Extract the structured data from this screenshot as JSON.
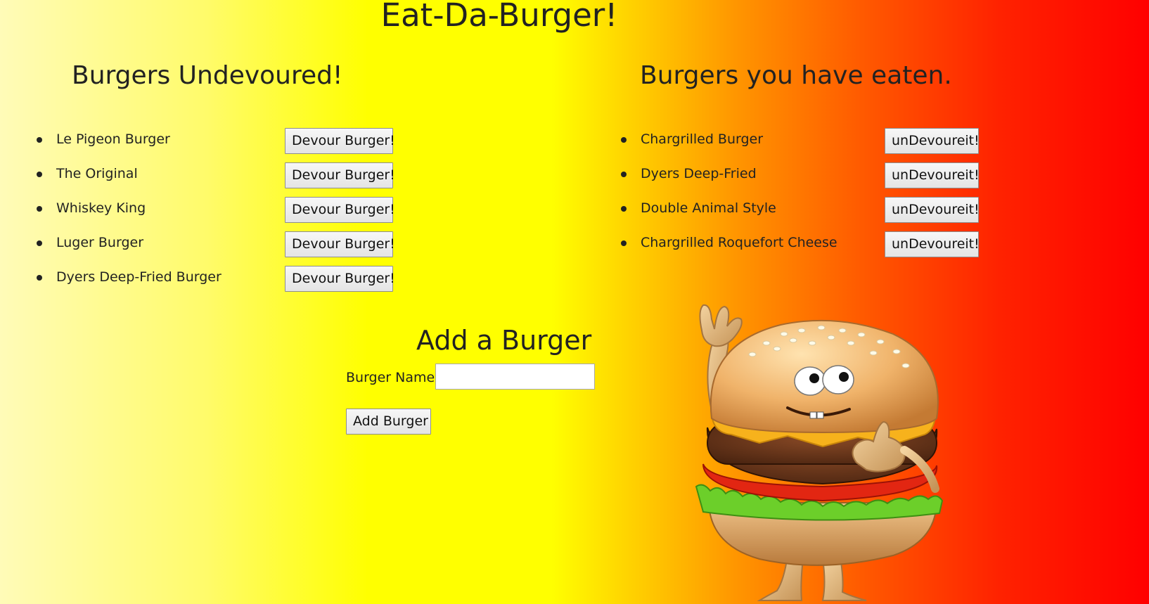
{
  "header": {
    "title": "Eat-Da-Burger!"
  },
  "undevoured": {
    "heading": "Burgers Undevoured!",
    "button_label": "Devour Burger!",
    "items": [
      {
        "name": "Le Pigeon Burger"
      },
      {
        "name": "The Original"
      },
      {
        "name": "Whiskey King"
      },
      {
        "name": "Luger Burger"
      },
      {
        "name": "Dyers Deep-Fried Burger"
      }
    ]
  },
  "devoured": {
    "heading": "Burgers you have eaten.",
    "button_label": "unDevoureit!",
    "items": [
      {
        "name": "Chargrilled Burger"
      },
      {
        "name": "Dyers Deep-Fried"
      },
      {
        "name": "Double Animal Style"
      },
      {
        "name": "Chargrilled Roquefort Cheese"
      }
    ]
  },
  "add_form": {
    "heading": "Add a Burger",
    "label": "Burger Name:",
    "input_value": "",
    "submit_label": "Add Burger"
  },
  "mascot": {
    "icon": "burger-mascot-icon"
  },
  "colors": {
    "gradient_left": "#fffbb8",
    "gradient_mid": "#ffff00",
    "gradient_orange": "#ff9600",
    "gradient_right": "#ff0000",
    "text": "#222222"
  }
}
